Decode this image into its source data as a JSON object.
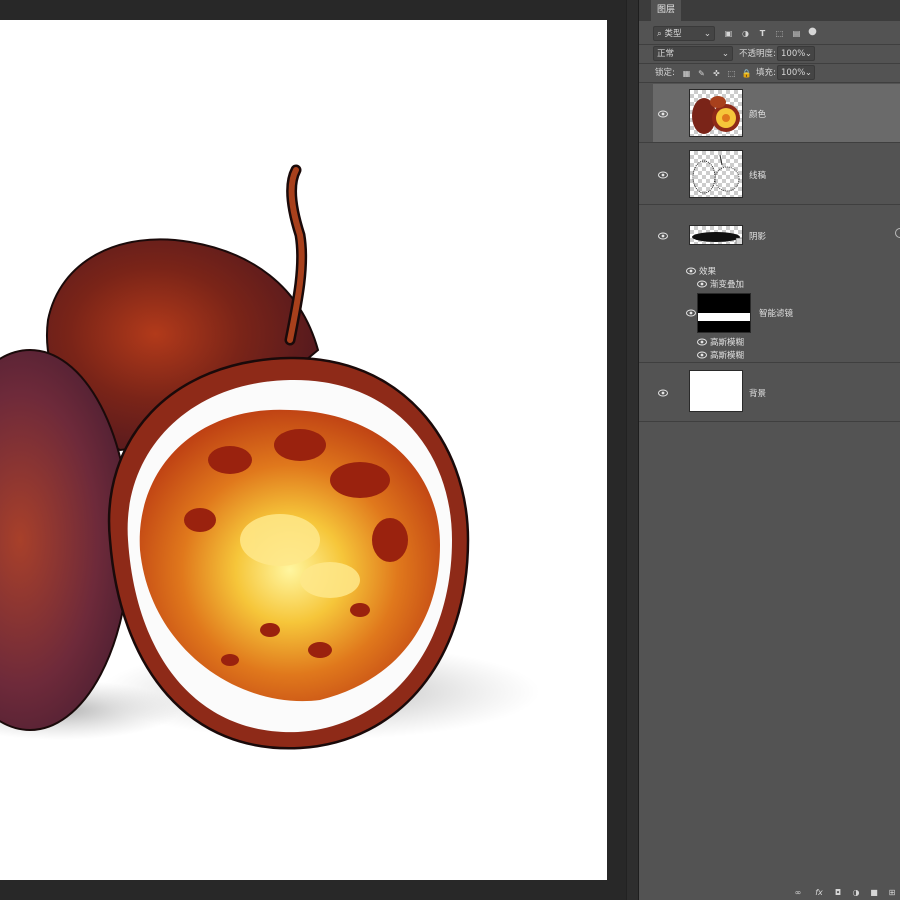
{
  "panel": {
    "tab_label": "图层",
    "filter": {
      "kind": "类型",
      "icons": [
        "image-filter-icon",
        "adjustment-filter-icon",
        "type-filter-icon",
        "shape-filter-icon",
        "smart-object-filter-icon",
        "filter-toggle-icon"
      ]
    },
    "blend_mode": "正常",
    "opacity_label": "不透明度:",
    "opacity_value": "100%",
    "lock_label": "锁定:",
    "fill_label": "填充:",
    "fill_value": "100%"
  },
  "layers": [
    {
      "name": "颜色",
      "selected": true
    },
    {
      "name": "线稿",
      "selected": false
    },
    {
      "name": "阴影",
      "selected": false
    },
    {
      "name": "背景",
      "selected": false
    }
  ],
  "effects": {
    "effects_label": "效果",
    "gradient_overlay": "渐变叠加",
    "smart_filters": "智能滤镜",
    "gaussian_blur_1": "高斯模糊",
    "gaussian_blur_2": "高斯模糊"
  },
  "bottom_icons": [
    "link-icon",
    "fx-icon",
    "mask-icon",
    "adjustment-icon",
    "folder-icon",
    "new-layer-icon"
  ],
  "colors": {
    "panel_bg": "#535353",
    "selected_layer": "#6a6a6a",
    "workspace": "#282828",
    "canvas": "#ffffff"
  }
}
